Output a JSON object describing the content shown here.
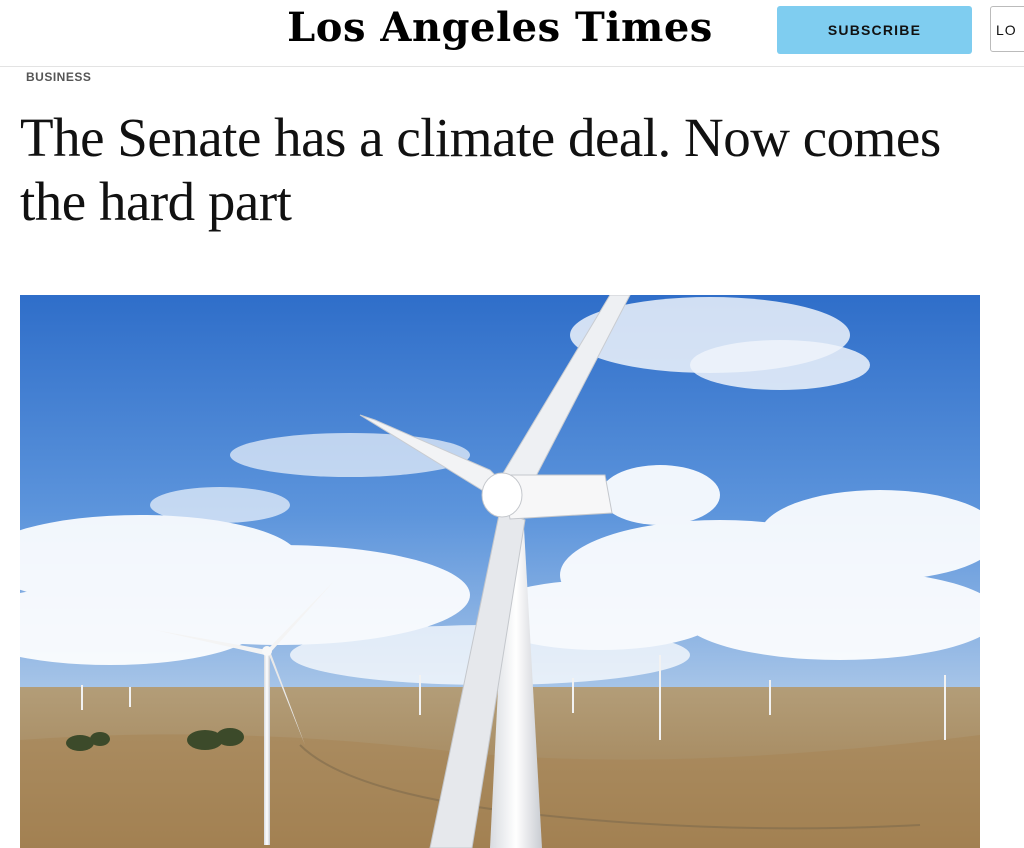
{
  "header": {
    "masthead": "Los Angeles Times",
    "subscribe_label": "SUBSCRIBE",
    "login_label": "LO"
  },
  "article": {
    "section": "BUSINESS",
    "headline": "The Senate has a climate deal. Now comes the hard part"
  },
  "colors": {
    "subscribe_bg": "#7fcdf0",
    "sky": "#3f7fd0",
    "ground": "#b89a6a"
  }
}
